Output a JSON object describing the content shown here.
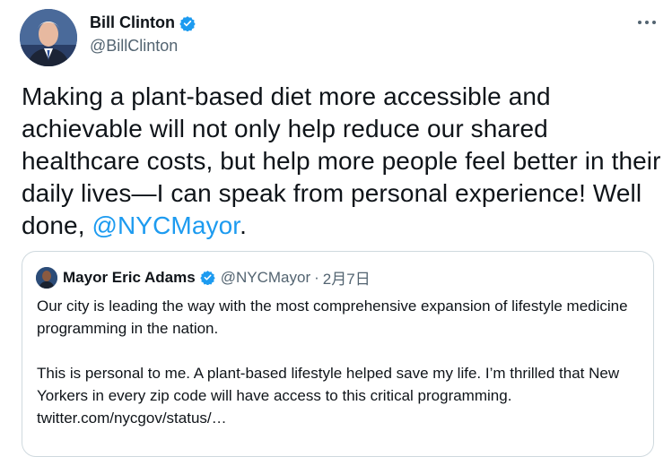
{
  "tweet": {
    "author": {
      "display_name": "Bill Clinton",
      "handle": "@BillClinton",
      "verified": true
    },
    "text_main": "Making a plant-based diet more accessible and achievable will not only help reduce our shared healthcare costs, but help more people feel better in their daily lives—I can speak from personal experience! Well done, ",
    "mention": "@NYCMayor",
    "text_end": "."
  },
  "quote": {
    "author": {
      "display_name": "Mayor Eric Adams",
      "handle": "@NYCMayor",
      "verified": true
    },
    "separator": "·",
    "date": "2月7日",
    "paragraph_1": "Our city is leading the way with the most comprehensive expansion of lifestyle medicine programming in the nation.",
    "paragraph_2": "This is personal to me. A plant-based lifestyle helped save my life. I’m thrilled that New Yorkers in every zip code will have access to this critical programming.",
    "link": "twitter.com/nycgov/status/…"
  },
  "colors": {
    "accent": "#1d9bf0",
    "text": "#0f1419",
    "secondary": "#536471",
    "border": "#cfd9de"
  },
  "icons": [
    "verified-badge-icon",
    "more-options-icon"
  ]
}
